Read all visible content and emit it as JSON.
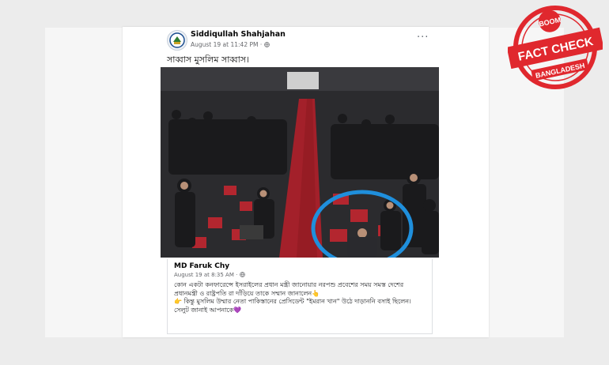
{
  "post": {
    "author": "Siddiqullah Shahjahan",
    "meta": "August 19 at 11:42 PM · ",
    "privacy_icon": "globe-icon",
    "more_label": "···",
    "text": "সাব্বাস মুসলিম সাব্বাস।"
  },
  "shared": {
    "author": "MD Faruk Chy",
    "meta": "August 19 at 8:35 AM · ",
    "body": "কোন একটা কনফারেন্সে ইসরাইলের প্রধান মন্ত্রী জানোয়ার নরপশু প্রবেশের সময় সমস্ত দেশের প্রধানমন্ত্রী ও রাষ্ট্রপতি রা দাঁড়িয়ে তাকে সম্মান জানালেন👆\n👉 কিন্তু মুসলিম উম্মার নেতা পাকিস্তানের প্রেসিডেন্ট \"ইমরান খান\" উঠে দাড়াননি বসাই ছিলেন।\nসেলুট জানাই আপনাকে💜"
  },
  "badge": {
    "top": "BOOM",
    "middle": "FACT CHECK",
    "bottom": "BANGLADESH"
  },
  "colors": {
    "badge_red": "#e0282e",
    "highlight_circle": "#1f8fdc",
    "fb_gray": "#65676b"
  }
}
